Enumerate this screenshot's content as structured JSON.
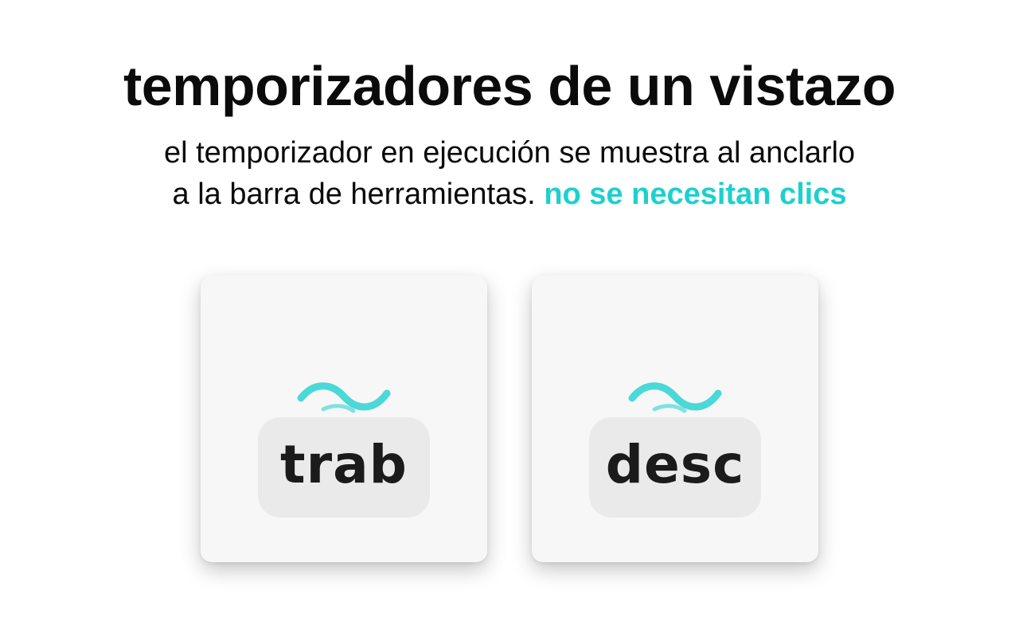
{
  "header": {
    "title": "temporizadores de un vistazo",
    "subtitle_line1": "el temporizador en ejecución se muestra al anclarlo",
    "subtitle_line2_prefix": "a la barra de herramientas.",
    "subtitle_highlight": "no se necesitan clics"
  },
  "colors": {
    "accent": "#1ecfcf",
    "text": "#0b0b0b"
  },
  "badges": [
    {
      "label": "trab",
      "icon": "wave-icon"
    },
    {
      "label": "desc",
      "icon": "wave-icon"
    }
  ]
}
